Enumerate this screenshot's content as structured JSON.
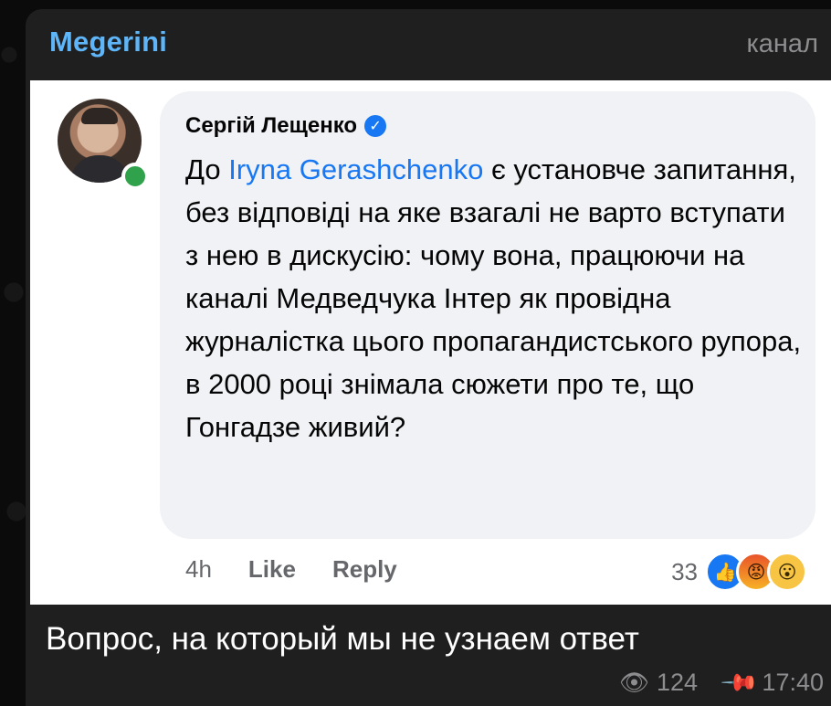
{
  "post": {
    "channel_name": "Megerini",
    "channel_tag": "канал",
    "caption": "Вопрос, на который мы не узнаем ответ",
    "views": "124",
    "time": "17:40"
  },
  "screenshot": {
    "author": "Сергій Лещенко",
    "text_before": "До ",
    "mention": "Iryna Gerashchenko",
    "text_after": " є установче запитання, без відповіді на яке взагалі не варто вступати з нею в дискусію: чому вона, працюючи на каналі Медведчука Інтер як провідна журналістка цього пропагандистського рупора, в 2000 році знімала сюжети про те, що Гонгадзе живий?",
    "time_ago": "4h",
    "like_label": "Like",
    "reply_label": "Reply",
    "reaction_count": "33",
    "reactions": [
      "like-icon",
      "angry-icon",
      "wow-icon"
    ]
  },
  "colors": {
    "channel_name": "#5eb5f7",
    "bubble": "#1f1f20",
    "mention": "#1877f2",
    "online": "#31a24c"
  }
}
